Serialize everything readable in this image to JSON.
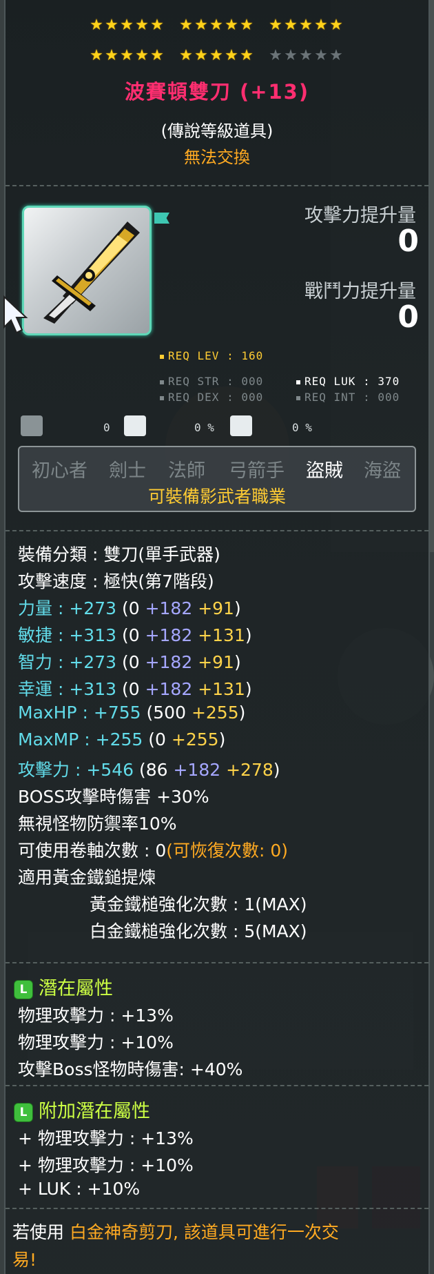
{
  "stars": {
    "rows": [
      [
        [
          1,
          1,
          1,
          1,
          1
        ],
        [
          1,
          1,
          1,
          1,
          1
        ],
        [
          1,
          1,
          1,
          1,
          1
        ]
      ],
      [
        [
          1,
          1,
          1,
          1,
          1
        ],
        [
          1,
          1,
          1,
          1,
          1
        ],
        [
          0,
          0,
          0,
          0,
          0
        ]
      ]
    ]
  },
  "item": {
    "name": "波賽頓雙刀 (+13)",
    "grade": "(傳說等級道具)",
    "trade": "無法交換"
  },
  "compare": {
    "atk_label": "攻擊力提升量",
    "atk_value": "0",
    "power_label": "戰鬥力提升量",
    "power_value": "0"
  },
  "requirements": {
    "lev": "REQ LEV : 160",
    "str": "REQ STR : 000",
    "luk": "REQ LUK : 370",
    "dex": "REQ DEX : 000",
    "int": "REQ INT : 000"
  },
  "small_stats": {
    "v1": "0",
    "v2": "0 %",
    "v3": "0 %"
  },
  "jobs": {
    "list": [
      "初心者",
      "劍士",
      "法師",
      "弓箭手",
      "盜賊",
      "海盜"
    ],
    "active_index": 4,
    "note": "可裝備影武者職業"
  },
  "stats": {
    "category": "裝備分類 : 雙刀(單手武器)",
    "speed": "攻擊速度 : 極快(第7階段)",
    "str": {
      "label": "力量",
      "sep": " : ",
      "total": "+273",
      "open": " (0 ",
      "add": "+182",
      "bonus": " +91",
      "close": ")"
    },
    "dex": {
      "label": "敏捷",
      "sep": " : ",
      "total": "+313",
      "open": " (0 ",
      "add": "+182",
      "bonus": " +131",
      "close": ")"
    },
    "int": {
      "label": "智力",
      "sep": " : ",
      "total": "+273",
      "open": " (0 ",
      "add": "+182",
      "bonus": " +91",
      "close": ")"
    },
    "luk": {
      "label": "幸運",
      "sep": " : ",
      "total": "+313",
      "open": " (0 ",
      "add": "+182",
      "bonus": " +131",
      "close": ")"
    },
    "hp": {
      "label": "MaxHP",
      "sep": " : ",
      "total": "+755",
      "open": " (500 ",
      "bonus": "+255",
      "close": ")"
    },
    "mp": {
      "label": "MaxMP",
      "sep": " : ",
      "total": "+255",
      "open": " (0 ",
      "bonus": "+255",
      "close": ")"
    },
    "atk": {
      "label": "攻擊力",
      "sep": " : ",
      "total": "+546",
      "open": " (86 ",
      "add": "+182",
      "bonus": " +278",
      "close": ")"
    },
    "boss": "BOSS攻擊時傷害 +30%",
    "ignore_def": "無視怪物防禦率10%",
    "scroll_label": "可使用卷軸次數 : 0",
    "scroll_restore": "(可恢復次數: 0)",
    "hammer": "適用黃金鐵鎚提煉",
    "gold_hammer": "黃金鐵槌強化次數 : 1(MAX)",
    "plat_hammer": "白金鐵槌強化次數 : 5(MAX)"
  },
  "potential": {
    "icon": "L",
    "title": "潛在屬性",
    "lines": [
      "物理攻擊力 : +13%",
      "物理攻擊力 : +10%",
      "攻擊Boss怪物時傷害: +40%"
    ]
  },
  "additional_potential": {
    "icon": "L",
    "title": "附加潛在屬性",
    "lines": [
      "+ 物理攻擊力 : +13%",
      "+ 物理攻擊力 : +10%",
      "+ LUK : +10%"
    ]
  },
  "footer": {
    "prefix": "若使用 ",
    "item": "白金神奇剪刀",
    "rest": ", 該道具可進行一次交",
    "rest2": "易!"
  },
  "colors": {
    "name": "#ff2e70",
    "trade": "#ffaa22",
    "stat_cyan": "#62dcea",
    "stat_blue": "#a5a7ff",
    "stat_yellow": "#ffd34a",
    "potential": "#ccff44"
  }
}
